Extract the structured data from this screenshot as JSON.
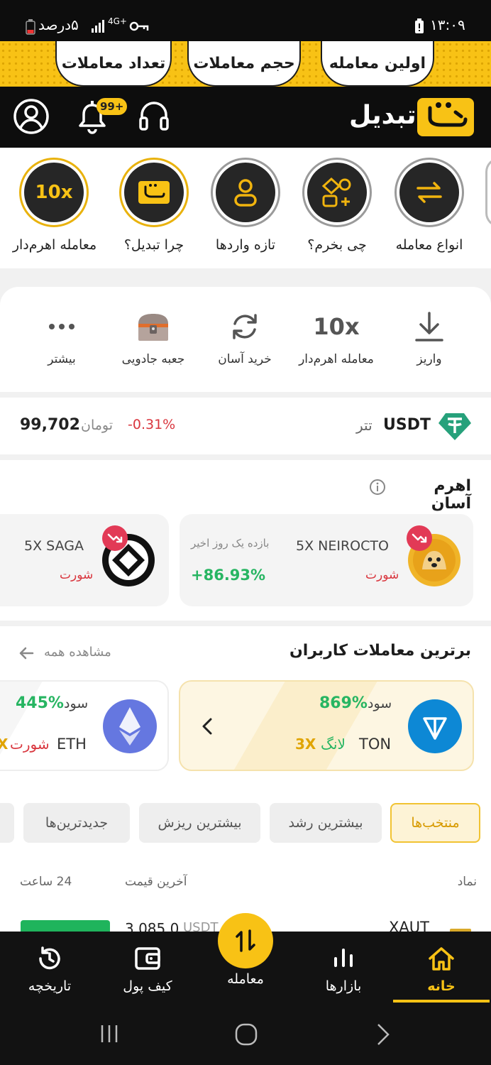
{
  "status_bar": {
    "time": "۱۳:۰۹",
    "battery": "۵درصد",
    "network": "4G+"
  },
  "promo": {
    "pills": [
      "اولین معامله",
      "حجم معاملات",
      "تعداد معاملات"
    ]
  },
  "header": {
    "brand": "تبدیل",
    "notification_badge": "99+"
  },
  "shortcuts": [
    {
      "label": "انواع معامله",
      "icon": "exchange-arrows-icon"
    },
    {
      "label": "چی بخرم؟",
      "icon": "shapes-icon"
    },
    {
      "label": "تازه واردها",
      "icon": "user-icon"
    },
    {
      "label": "چرا تبدیل؟",
      "icon": "tabdil-logo-icon"
    },
    {
      "label": "معامله اهرم‌دار",
      "icon_text": "10x"
    }
  ],
  "quick_actions": [
    {
      "label": "واریز",
      "icon": "download-icon"
    },
    {
      "label": "معامله اهرم‌دار",
      "icon_text": "10x"
    },
    {
      "label": "خرید آسان",
      "icon": "refresh-icon"
    },
    {
      "label": "جعبه جادویی",
      "icon": "chest-icon"
    },
    {
      "label": "بیشتر",
      "icon": "more-dots-icon"
    }
  ],
  "usdt": {
    "symbol": "USDT",
    "name": "تتر",
    "change": "-0.31%",
    "unit": "تومان",
    "price": "99,702"
  },
  "leverage": {
    "title": "اهرم آسان",
    "cards": [
      {
        "symbol": "5X NEIROCTO",
        "direction": "شورت",
        "period": "بازده یک روز اخیر",
        "return": "+86.93%"
      },
      {
        "symbol": "5X SAGA",
        "direction": "شورت"
      }
    ]
  },
  "top_trades": {
    "title": "برترین معاملات کاربران",
    "see_all": "مشاهده همه",
    "cards": [
      {
        "symbol": "TON",
        "side": "لانگ",
        "leverage": "3X",
        "profit_label": "سود",
        "profit": "869%"
      },
      {
        "symbol": "ETH",
        "side": "شورت",
        "leverage": "X",
        "profit_label": "سود",
        "profit": "445%"
      }
    ]
  },
  "filters": [
    "منتخب‌ها",
    "بیشترین رشد",
    "بیشترین ریزش",
    "جدیدترین‌ها"
  ],
  "table": {
    "headers": {
      "symbol": "نماد",
      "last_price": "آخرین قیمت",
      "change_24h": "24 ساعت"
    },
    "first_row": {
      "symbol": "XAUT",
      "price": "3,085.0",
      "unit": "USDT"
    }
  },
  "bottom_nav": [
    {
      "label": "خانه",
      "icon": "home-icon",
      "active": true
    },
    {
      "label": "بازارها",
      "icon": "bar-chart-icon"
    },
    {
      "label": "معامله",
      "icon": "swap-vertical-icon"
    },
    {
      "label": "کیف پول",
      "icon": "wallet-icon"
    },
    {
      "label": "تاریخچه",
      "icon": "history-icon"
    }
  ],
  "colors": {
    "accent": "#f8c215",
    "positive": "#27b562",
    "negative": "#d9363e",
    "dark": "#0d0d0d"
  }
}
